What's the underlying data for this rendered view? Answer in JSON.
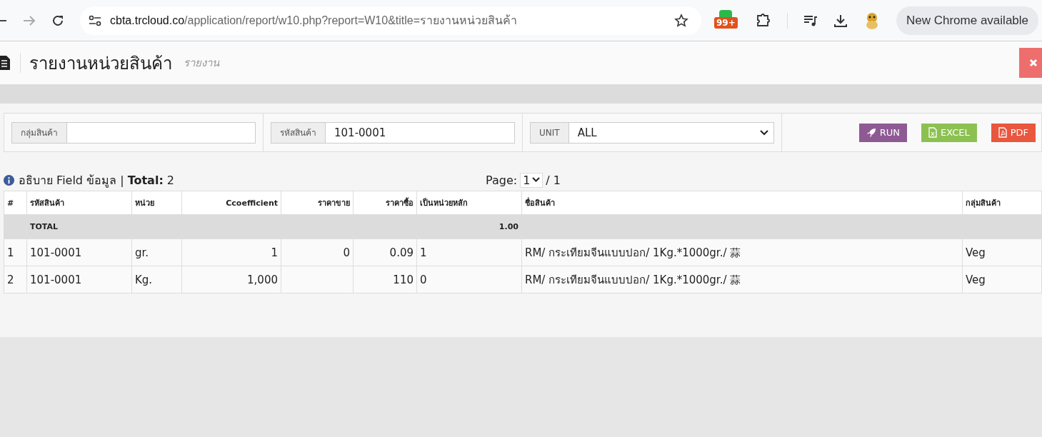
{
  "browser": {
    "url_host": "cbta.trcloud.co",
    "url_path": "/application/report/w10.php?report=W10&title=รายงานหน่วยสินค้า",
    "extension_badge": "99+",
    "update_pill": "New Chrome available"
  },
  "header": {
    "title": "รายงานหน่วยสินค้า",
    "subtitle": "รายงาน"
  },
  "filters": [
    {
      "label": "กลุ่มสินค้า",
      "kind": "text"
    },
    {
      "label": "รหัสสินค้า",
      "value": "101-0001",
      "kind": "text"
    },
    {
      "label": "UNIT",
      "value": "ALL",
      "kind": "select"
    }
  ],
  "buttons": [
    {
      "label": "RUN",
      "kind": "run"
    },
    {
      "label": "EXCEL",
      "kind": "excel"
    },
    {
      "label": "PDF",
      "kind": "pdf"
    }
  ],
  "info": {
    "text": "อธิบาย Field ข้อมูล |",
    "total_label": "Total:",
    "total_value": "2"
  },
  "pagination": {
    "label": "Page:",
    "current": "1",
    "of": "/ 1"
  },
  "table": {
    "columns": [
      {
        "label": "#",
        "kind": "text"
      },
      {
        "label": "รหัสสินค้า",
        "kind": "text"
      },
      {
        "label": "หน่วย",
        "kind": "text"
      },
      {
        "label": "Ccoefficient",
        "kind": "number"
      },
      {
        "label": "ราคาขาย",
        "kind": "number"
      },
      {
        "label": "ราคาซื้อ",
        "kind": "number"
      },
      {
        "label": "เป็นหน่วยหลัก",
        "kind": "text"
      },
      {
        "label": "ชื่อสินค้า",
        "kind": "text"
      },
      {
        "label": "กลุ่มสินค้า",
        "kind": "text"
      }
    ],
    "total_row": {
      "label": "TOTAL",
      "value": "1.00"
    },
    "rows": [
      [
        "1",
        "101-0001",
        "gr.",
        "1",
        "0",
        "0.09",
        "1",
        "RM/ กระเทียมจีนแบบปอก/ 1Kg.*1000gr./ 蒜",
        "Veg"
      ],
      [
        "2",
        "101-0001",
        "Kg.",
        "1,000",
        "",
        "110",
        "0",
        "RM/ กระเทียมจีนแบบปอก/ 1Kg.*1000gr./ 蒜",
        "Veg"
      ]
    ]
  }
}
